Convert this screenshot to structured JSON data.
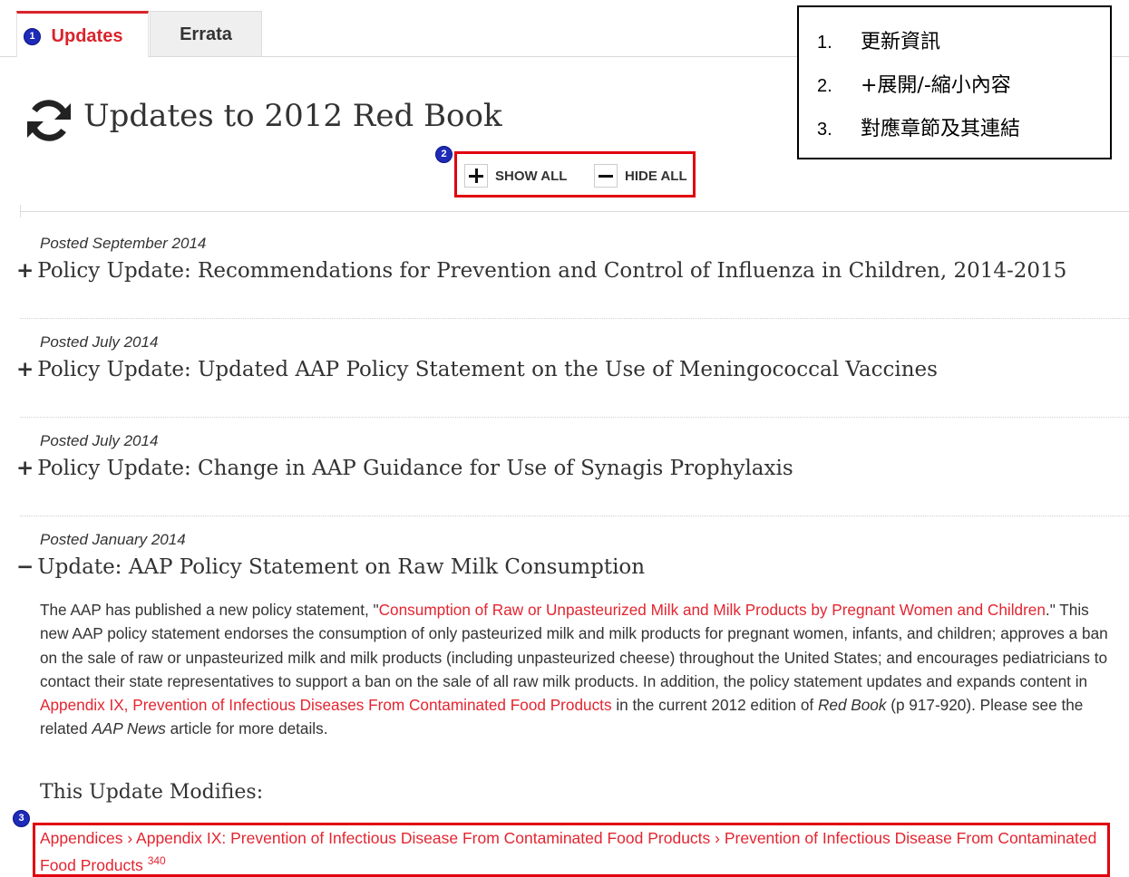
{
  "tabs": [
    {
      "label": "Updates",
      "active": true
    },
    {
      "label": "Errata",
      "active": false
    }
  ],
  "badges": [
    "1",
    "2",
    "3"
  ],
  "page_title": "Updates to 2012 Red Book",
  "controls": {
    "show_all": "SHOW ALL",
    "hide_all": "HIDE ALL"
  },
  "annotation": [
    {
      "num": "1.",
      "text": "更新資訊"
    },
    {
      "num": "2.",
      "text": "+展開/-縮小內容"
    },
    {
      "num": "3.",
      "text": "對應章節及其連結"
    }
  ],
  "updates": [
    {
      "posted": "Posted September 2014",
      "toggle": "+",
      "title": "Policy Update: Recommendations for Prevention and Control of Influenza in Children, 2014-2015"
    },
    {
      "posted": "Posted July 2014",
      "toggle": "+",
      "title": "Policy Update: Updated AAP Policy Statement on the Use of Meningococcal Vaccines"
    },
    {
      "posted": "Posted July 2014",
      "toggle": "+",
      "title": "Policy Update: Change in AAP Guidance for Use of Synagis Prophylaxis"
    },
    {
      "posted": "Posted January 2014",
      "toggle": "−",
      "title": "Update: AAP Policy Statement on Raw Milk Consumption"
    }
  ],
  "expanded": {
    "t1": "The AAP has published a new policy statement, \"",
    "link1": "Consumption of Raw or Unpasteurized Milk and Milk Products by Pregnant Women and Children",
    "t2": ".\" This new AAP policy statement endorses the consumption of only pasteurized milk and milk products for pregnant women, infants, and children; approves a ban on the sale of raw or unpasteurized milk and milk products (including unpasteurized cheese) throughout the United States; and encourages pediatricians to contact their state representatives to support a ban on the sale of all raw milk products. In addition, the policy statement updates and expands content in ",
    "link2": "Appendix IX, Prevention of Infectious Diseases From Contaminated Food Products",
    "t3": " in the current 2012 edition of ",
    "em1": "Red Book",
    "t4": " (p 917-920). Please see the related ",
    "em2": "AAP News",
    "t5": " article for more details.",
    "modifies_heading": "This Update Modifies:",
    "modifies_link": "Appendices › Appendix IX: Prevention of Infectious Disease From Contaminated Food Products › Prevention of Infectious Disease From Contaminated Food Products",
    "modifies_page": "340"
  },
  "colors": {
    "accent": "#d9242b",
    "highlight_box": "#e0000f",
    "badge": "#1e2bb8"
  }
}
